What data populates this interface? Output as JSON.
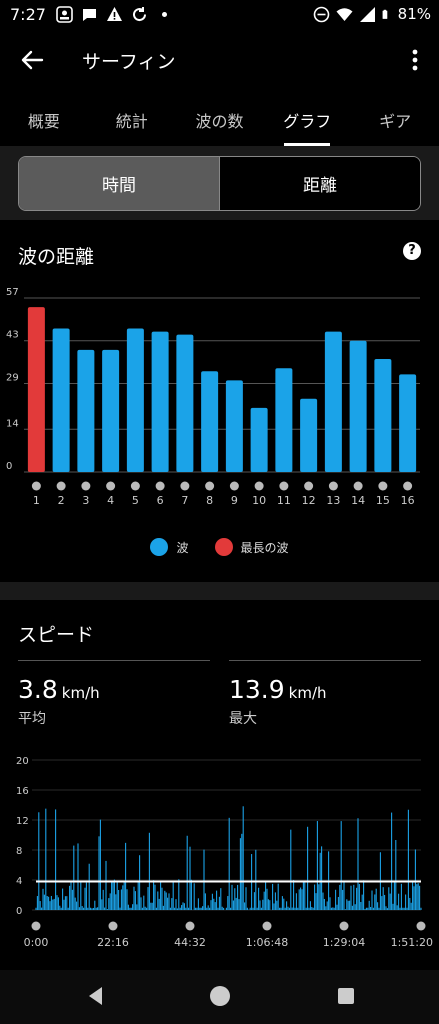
{
  "status_bar": {
    "time": "7:27",
    "battery": "81%",
    "icons_left": [
      "photo-icon",
      "message-icon",
      "warning-icon",
      "sync-icon",
      "dot-icon"
    ],
    "icons_right": [
      "dnd-icon",
      "wifi-icon",
      "signal-icon",
      "battery-icon"
    ]
  },
  "app_bar": {
    "title": "サーフィン"
  },
  "tabs": [
    {
      "label": "概要",
      "active": false
    },
    {
      "label": "統計",
      "active": false
    },
    {
      "label": "波の数",
      "active": false
    },
    {
      "label": "グラフ",
      "active": true
    },
    {
      "label": "ギア",
      "active": false
    }
  ],
  "segment": {
    "options": [
      "時間",
      "距離"
    ],
    "selected": "時間"
  },
  "wave_distance": {
    "title": "波の距離",
    "help_label": "?",
    "chart_data": {
      "type": "bar",
      "categories": [
        "1",
        "2",
        "3",
        "4",
        "5",
        "6",
        "7",
        "8",
        "9",
        "10",
        "11",
        "12",
        "13",
        "14",
        "15",
        "16"
      ],
      "values": [
        54,
        47,
        40,
        40,
        47,
        46,
        45,
        33,
        30,
        21,
        34,
        24,
        46,
        43,
        37,
        32
      ],
      "highlight_index": 0,
      "y_ticks": [
        0,
        14,
        29,
        43,
        57
      ],
      "ylim": [
        0,
        57
      ],
      "grid": true,
      "colors": {
        "bar": "#1ba3e8",
        "highlight": "#e23a3a"
      },
      "legend": [
        {
          "label": "波",
          "color": "#1ba3e8"
        },
        {
          "label": "最長の波",
          "color": "#e23a3a"
        }
      ]
    }
  },
  "speed": {
    "title": "スピード",
    "average": {
      "value": "3.8",
      "unit": "km/h",
      "label": "平均"
    },
    "max": {
      "value": "13.9",
      "unit": "km/h",
      "label": "最大"
    },
    "chart_data": {
      "type": "area",
      "y_ticks": [
        0,
        4,
        8,
        12,
        16,
        20
      ],
      "ylim": [
        0,
        20
      ],
      "x_ticks": [
        "0:00",
        "22:16",
        "44:32",
        "1:06:48",
        "1:29:04",
        "1:51:20"
      ],
      "average_line": 3.8,
      "color": "#1ba3e8"
    }
  },
  "nav_bar": {
    "buttons": [
      "back-nav-icon",
      "home-nav-icon",
      "recents-nav-icon"
    ]
  }
}
